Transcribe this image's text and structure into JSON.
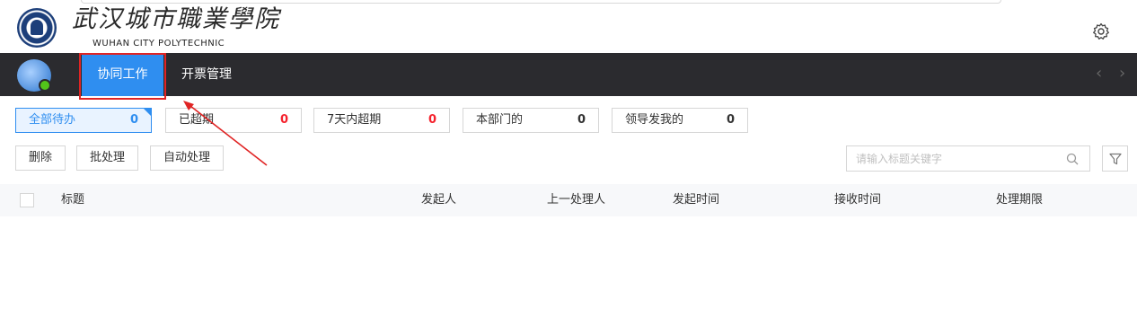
{
  "header": {
    "logo_cn": "武汉城市職業學院",
    "logo_en": "WUHAN CITY POLYTECHNIC",
    "settings_icon": "gear-icon"
  },
  "navbar": {
    "tabs": [
      {
        "label": "协同工作",
        "active": true
      },
      {
        "label": "开票管理",
        "active": false
      }
    ],
    "prev_glyph": "‹",
    "next_glyph": "›"
  },
  "filters": [
    {
      "label": "全部待办",
      "count": "0",
      "active": true
    },
    {
      "label": "已超期",
      "count": "0",
      "active": false,
      "count_color": "#f5222d"
    },
    {
      "label": "7天内超期",
      "count": "0",
      "active": false,
      "count_color": "#f5222d"
    },
    {
      "label": "本部门的",
      "count": "0",
      "active": false
    },
    {
      "label": "领导发我的",
      "count": "0",
      "active": false
    }
  ],
  "actions": {
    "delete": "删除",
    "batch": "批处理",
    "auto": "自动处理"
  },
  "search": {
    "placeholder": "请输入标题关键字",
    "value": ""
  },
  "table": {
    "columns": [
      "标题",
      "发起人",
      "上一处理人",
      "发起时间",
      "接收时间",
      "处理期限"
    ],
    "rows": []
  },
  "colors": {
    "accent": "#2f8ef0",
    "navbar": "#2b2b2f",
    "alert": "#f5222d",
    "annotation": "#e02424"
  }
}
